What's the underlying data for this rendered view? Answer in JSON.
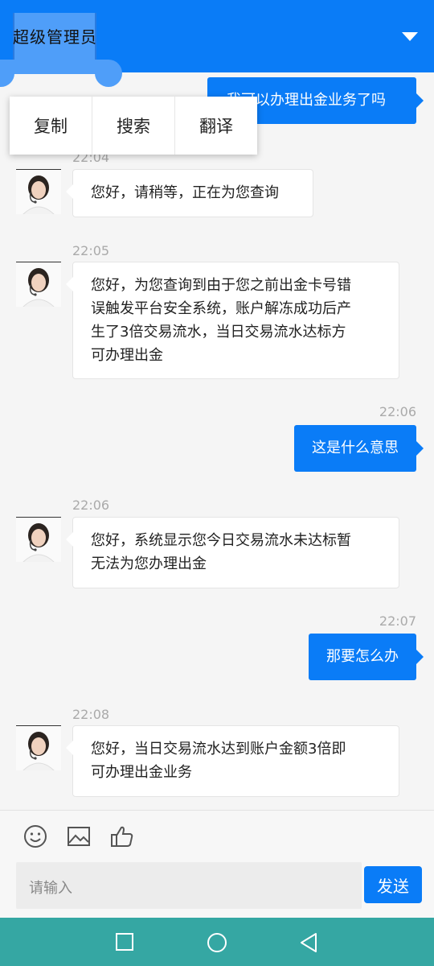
{
  "header": {
    "title": "超级管理员"
  },
  "context_menu": {
    "items": [
      "复制",
      "搜索",
      "翻译"
    ]
  },
  "messages": [
    {
      "side": "out",
      "text": "我可以办理出金业务了吗"
    },
    {
      "side": "in",
      "time": "22:04",
      "text": "您好，请稍等，正在为您查询"
    },
    {
      "side": "in",
      "time": "22:05",
      "lines": [
        "您好，为您查询到由于您之前出金卡号错",
        "误触发平台安全系统，账户解冻成功后产",
        "生了3倍交易流水，当日交易流水达标方",
        "可办理出金"
      ]
    },
    {
      "side": "out",
      "time": "22:06",
      "text": "这是什么意思"
    },
    {
      "side": "in",
      "time": "22:06",
      "lines": [
        "您好，系统显示您今日交易流水未达标暂",
        "无法为您办理出金"
      ]
    },
    {
      "side": "out",
      "time": "22:07",
      "text": "那要怎么办"
    },
    {
      "side": "in",
      "time": "22:08",
      "lines": [
        "您好，当日交易流水达到账户金额3倍即",
        "可办理出金业务"
      ]
    }
  ],
  "composer": {
    "placeholder": "请输入",
    "send_label": "发送",
    "tools": [
      "emoji-icon",
      "image-icon",
      "thumbs-up-icon"
    ]
  },
  "navbar": {
    "buttons": [
      "recent-apps-icon",
      "home-icon",
      "back-icon"
    ]
  },
  "colors": {
    "primary": "#0a7cf7",
    "navbar": "#35a7a3"
  }
}
